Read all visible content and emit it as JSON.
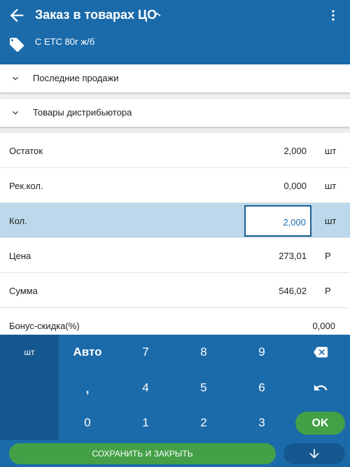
{
  "header": {
    "title": "Заказ в товарах ЦО",
    "subtitle": "С ETC 80г ж/б",
    "icons": [
      "arrow-back-icon",
      "chevron-up-icon",
      "more-vert-icon",
      "tag-icon"
    ]
  },
  "panels": [
    {
      "label": "Последние продажи",
      "icon": "chevron-down-icon"
    },
    {
      "label": "Товары дистрибьютора",
      "icon": "chevron-down-icon"
    }
  ],
  "fields": [
    {
      "label": "Остаток",
      "value": "2,000",
      "unit": "шт"
    },
    {
      "label": "Рек.кол.",
      "value": "0,000",
      "unit": "шт"
    },
    {
      "label": "Кол.",
      "value": "2,000",
      "unit": "шт"
    },
    {
      "label": "Цена",
      "value": "273,01",
      "unit": "Р"
    },
    {
      "label": "Сумма",
      "value": "546,02",
      "unit": "Р"
    },
    {
      "label": "Бонус-скидка(%)",
      "value": "0,000",
      "unit": ""
    }
  ],
  "keypad": {
    "unit_label": "шт",
    "auto_label": "Авто",
    "comma": ",",
    "digits": [
      "7",
      "8",
      "9",
      "4",
      "5",
      "6",
      "0",
      "1",
      "2",
      "3"
    ],
    "ok_label": "OK",
    "icons": [
      "backspace-icon",
      "undo-icon"
    ]
  },
  "actions": {
    "save_label": "СОХРАНИТЬ И ЗАКРЫТЬ",
    "down_icon": "arrow-down-icon"
  },
  "colors": {
    "primary": "#1b6bab",
    "primary_dark": "#15588f",
    "accent_green": "#43a047",
    "selected_row": "#bcd8ea"
  }
}
